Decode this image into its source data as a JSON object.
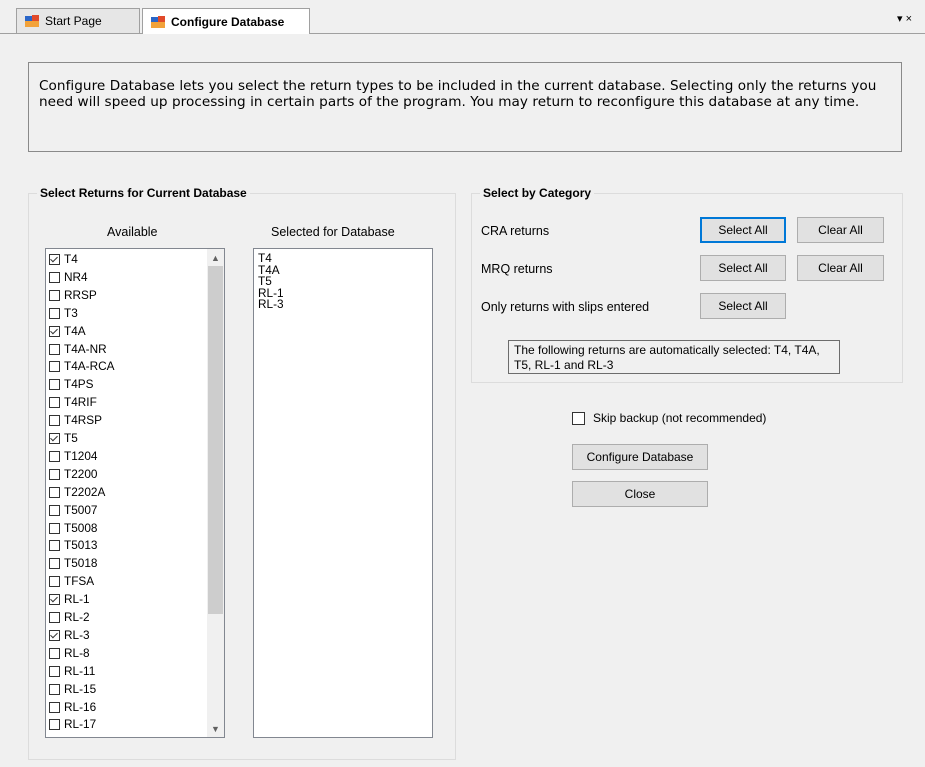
{
  "tabs": {
    "start_page": "Start Page",
    "configure_database": "Configure Database",
    "menu_glyph": "▾ ×"
  },
  "intro_text": "Configure Database lets you select the return types to be included in the current database. Selecting only the returns you need will speed up processing in certain parts of the program. You may return to reconfigure this database at any time.",
  "select_returns": {
    "title": "Select Returns for Current Database",
    "available_label": "Available",
    "selected_label": "Selected for Database",
    "available_items": [
      {
        "label": "T4",
        "checked": true
      },
      {
        "label": "NR4",
        "checked": false
      },
      {
        "label": "RRSP",
        "checked": false
      },
      {
        "label": "T3",
        "checked": false
      },
      {
        "label": "T4A",
        "checked": true
      },
      {
        "label": "T4A-NR",
        "checked": false
      },
      {
        "label": "T4A-RCA",
        "checked": false
      },
      {
        "label": "T4PS",
        "checked": false
      },
      {
        "label": "T4RIF",
        "checked": false
      },
      {
        "label": "T4RSP",
        "checked": false
      },
      {
        "label": "T5",
        "checked": true
      },
      {
        "label": "T1204",
        "checked": false
      },
      {
        "label": "T2200",
        "checked": false
      },
      {
        "label": "T2202A",
        "checked": false
      },
      {
        "label": "T5007",
        "checked": false
      },
      {
        "label": "T5008",
        "checked": false
      },
      {
        "label": "T5013",
        "checked": false
      },
      {
        "label": "T5018",
        "checked": false
      },
      {
        "label": "TFSA",
        "checked": false
      },
      {
        "label": "RL-1",
        "checked": true
      },
      {
        "label": "RL-2",
        "checked": false
      },
      {
        "label": "RL-3",
        "checked": true
      },
      {
        "label": "RL-8",
        "checked": false
      },
      {
        "label": "RL-11",
        "checked": false
      },
      {
        "label": "RL-15",
        "checked": false
      },
      {
        "label": "RL-16",
        "checked": false
      },
      {
        "label": "RL-17",
        "checked": false
      }
    ],
    "selected_items": [
      "T4",
      "T4A",
      "T5",
      "RL-1",
      "RL-3"
    ]
  },
  "category": {
    "title": "Select by Category",
    "cra_label": "CRA returns",
    "mrq_label": "MRQ returns",
    "slips_label": "Only returns with slips entered",
    "select_all": "Select All",
    "clear_all": "Clear All",
    "note": "The following returns are automatically selected: T4, T4A, T5, RL-1 and RL-3"
  },
  "actions": {
    "skip_backup": "Skip backup (not recommended)",
    "skip_backup_checked": false,
    "configure_database": "Configure Database",
    "close": "Close"
  }
}
